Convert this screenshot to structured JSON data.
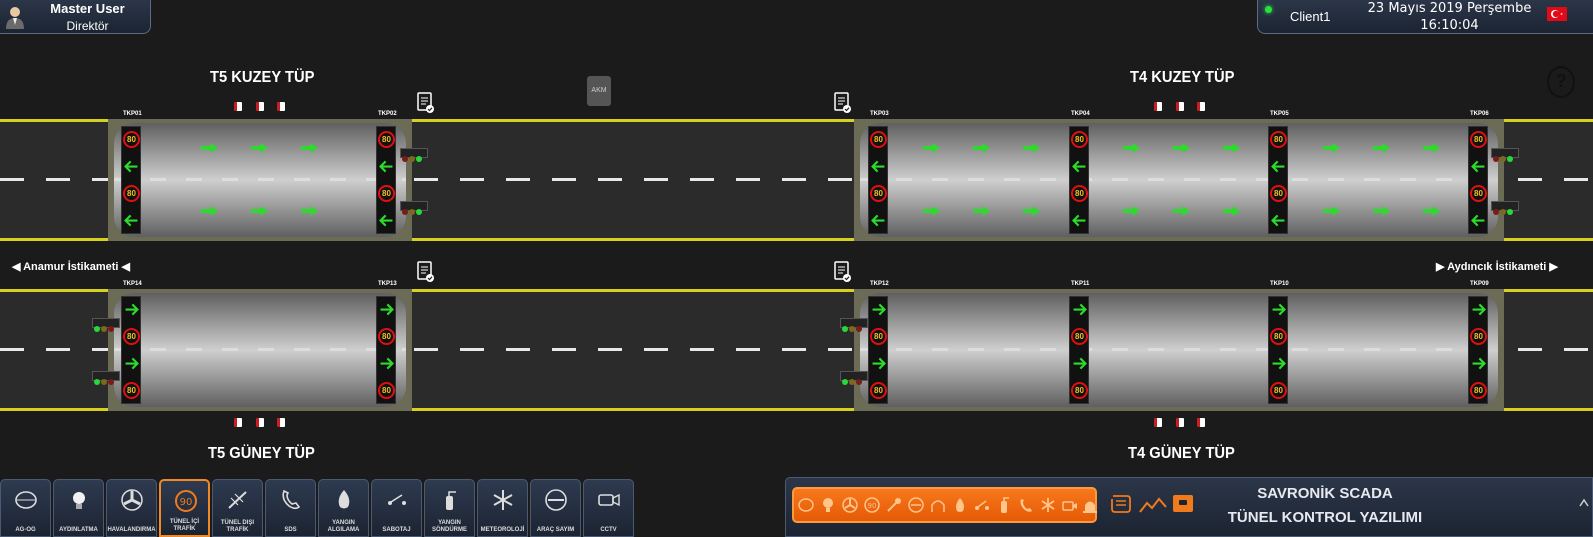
{
  "user": {
    "name": "Master User",
    "role": "Direktör",
    "avatar_icon": "user-avatar-icon"
  },
  "client": {
    "name": "Client1",
    "date": "23 Mayıs 2019 Perşembe",
    "time": "16:10:04",
    "status": "online",
    "flag_icon": "turkey-flag-icon"
  },
  "help": {
    "label": "?"
  },
  "tubes": {
    "t5_north": "T5 KUZEY TÜP",
    "t4_north": "T4 KUZEY TÜP",
    "t5_south": "T5 GÜNEY TÜP",
    "t4_south": "T4 GÜNEY TÜP"
  },
  "akm": {
    "label": "AKM"
  },
  "directions": {
    "left": "◀ Anamur İstikameti ◀",
    "right": "▶ Aydıncık İstikameti ▶"
  },
  "north_vms": [
    {
      "id": "TKP01",
      "speed": "80"
    },
    {
      "id": "TKP02",
      "speed": "80"
    },
    {
      "id": "TKP03",
      "speed": "80"
    },
    {
      "id": "TKP04",
      "speed": "80"
    },
    {
      "id": "TKP05",
      "speed": "80"
    },
    {
      "id": "TKP06",
      "speed": "80"
    }
  ],
  "south_vms": [
    {
      "id": "TKP14",
      "speed": "80"
    },
    {
      "id": "TKP13",
      "speed": "80"
    },
    {
      "id": "TKP12",
      "speed": "80"
    },
    {
      "id": "TKP11",
      "speed": "80"
    },
    {
      "id": "TKP10",
      "speed": "80"
    },
    {
      "id": "TKP09",
      "speed": "80"
    }
  ],
  "toolbar": [
    {
      "label": "AG-OG",
      "icon": "power-grid-icon"
    },
    {
      "label": "AYDINLATMA",
      "icon": "bulb-icon"
    },
    {
      "label": "HAVALANDIRMA",
      "icon": "fan-icon"
    },
    {
      "label": "TÜNEL İÇİ TRAFİK",
      "icon": "speed-sign-icon",
      "active": true,
      "badge": "90"
    },
    {
      "label": "TÜNEL DIŞI TRAFİK",
      "icon": "road-works-icon"
    },
    {
      "label": "SDS",
      "icon": "phone-icon"
    },
    {
      "label": "YANGIN ALGILAMA",
      "icon": "fire-icon"
    },
    {
      "label": "SABOTAJ",
      "icon": "switch-icon"
    },
    {
      "label": "YANGIN SÖNDÜRME",
      "icon": "extinguisher-icon"
    },
    {
      "label": "METEOROLOJİ",
      "icon": "snowflake-icon"
    },
    {
      "label": "ARAÇ SAYIM",
      "icon": "counter-icon"
    },
    {
      "label": "CCTV",
      "icon": "camera-icon"
    }
  ],
  "scada": {
    "title": "SAVRONİK SCADA",
    "subtitle": "TÜNEL KONTROL YAZILIMI"
  },
  "colors": {
    "accent": "#f07a1c",
    "road_line": "#d8d020",
    "arrow": "#2bdc2b",
    "speed_ring": "#e01010"
  }
}
